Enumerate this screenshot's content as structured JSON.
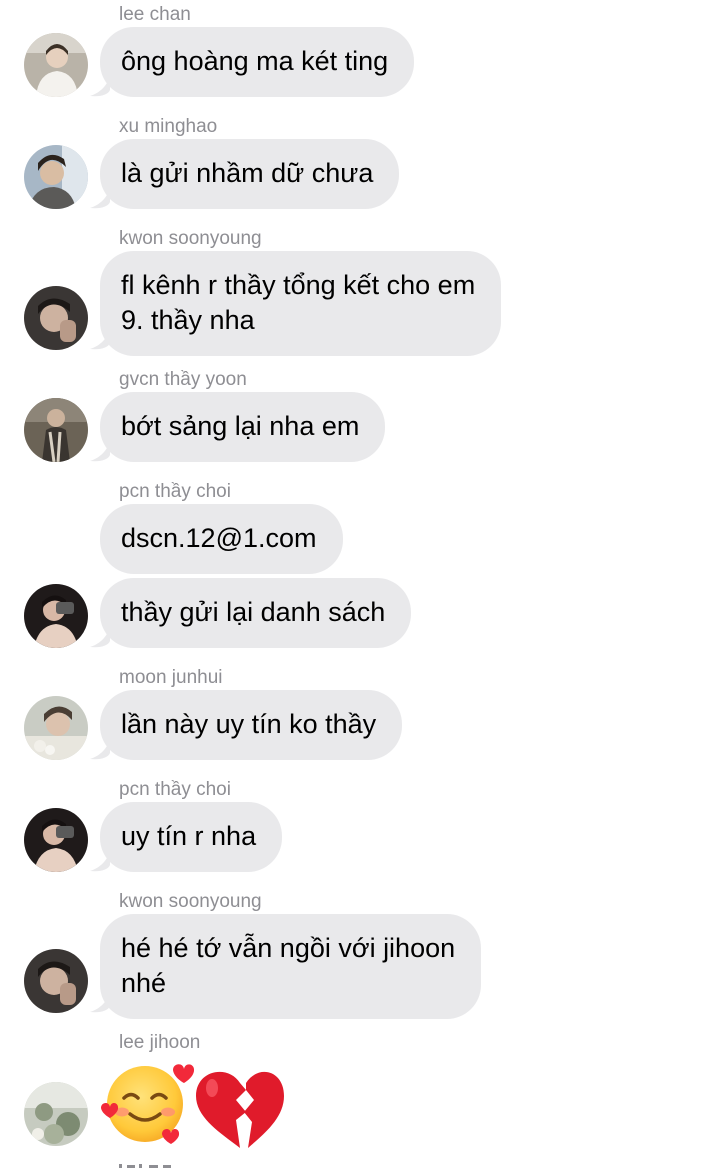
{
  "messages": [
    {
      "sender": "lee chan",
      "text": "ông hoàng ma két ting"
    },
    {
      "sender": "xu minghao",
      "text": "là gửi nhầm dữ chưa"
    },
    {
      "sender": "kwon soonyoung",
      "line1": "fl kênh r thầy tổng kết cho em",
      "line2": "9. thầy nha"
    },
    {
      "sender": "gvcn thầy yoon",
      "text": "bớt sảng lại nha em"
    },
    {
      "sender": "pcn thầy choi",
      "text1": "dscn.12@1.com",
      "text2": "thầy gửi lại danh sách"
    },
    {
      "sender": "moon junhui",
      "text": "lần này uy tín ko thầy"
    },
    {
      "sender": "pcn thầy choi",
      "text": "uy tín r nha"
    },
    {
      "sender": "kwon soonyoung",
      "line1": "hé hé tớ vẫn ngồi với jihoon",
      "line2": "nhé"
    },
    {
      "sender": "lee jihoon",
      "emojis": [
        "smiling-face-with-hearts",
        "broken-heart"
      ]
    }
  ],
  "colors": {
    "bubble": "#e9e9eb",
    "sender": "#8e8e93",
    "text": "#000000"
  }
}
